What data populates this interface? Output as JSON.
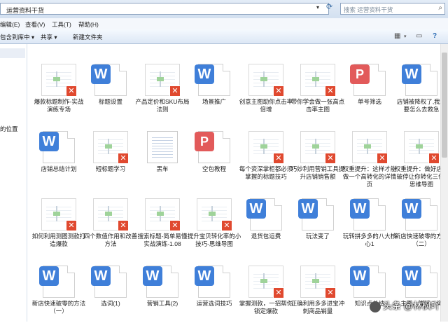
{
  "address": {
    "path": "运营资料干货",
    "search_placeholder": "搜索 运营资料干货"
  },
  "menu": [
    "编辑(E)",
    "查看(V)",
    "工具(T)",
    "帮助(H)"
  ],
  "toolbar": {
    "include": "包含到库中 ▾",
    "share": "共享 ▾",
    "new_folder": "新建文件夹"
  },
  "nav": {
    "location": "的位置"
  },
  "files": [
    {
      "name": "爆款标题制作-实战演练专场",
      "type": "ppt"
    },
    {
      "name": "标题设置",
      "type": "w"
    },
    {
      "name": "产品定价和SKU布局法则",
      "type": "ppt"
    },
    {
      "name": "场景推广",
      "type": "w"
    },
    {
      "name": "创意主图助你点击率倍增",
      "type": "ppt"
    },
    {
      "name": "带你学会做一张高点击率主图",
      "type": "ppt"
    },
    {
      "name": "单号筛选",
      "type": "p"
    },
    {
      "name": "店铺被降权了,我们要怎么去救急",
      "type": "w"
    },
    {
      "name": "店铺总结计划",
      "type": "w"
    },
    {
      "name": "短标题学习",
      "type": "ppt"
    },
    {
      "name": "黑车",
      "type": "txt"
    },
    {
      "name": "空包教程",
      "type": "p"
    },
    {
      "name": "每个资深掌柜都必须掌握的标题技巧",
      "type": "ppt"
    },
    {
      "name": "巧妙利用营销工具提升店铺销售额",
      "type": "ppt"
    },
    {
      "name": "权重提升：这样才能做一个高转化的详情页",
      "type": "ppt"
    },
    {
      "name": "权重提升：做好店铺破停让你转化三倍-思维导图",
      "type": "ppt"
    },
    {
      "name": "如何利用测图测款打造爆款",
      "type": "ppt"
    },
    {
      "name": "四个数值作用和改善方法",
      "type": "ppt"
    },
    {
      "name": "搜索标题-简单易懂实战演练-1.08",
      "type": "ppt"
    },
    {
      "name": "提升宝贝转化率的小技巧-思维导图",
      "type": "ppt"
    },
    {
      "name": "退货包运费",
      "type": "w"
    },
    {
      "name": "玩法变了",
      "type": "w"
    },
    {
      "name": "玩转拼多多的八大核心1",
      "type": "w"
    },
    {
      "name": "新店快速破零的方法（二）",
      "type": "w"
    },
    {
      "name": "新店快速破零的方法（一）",
      "type": "w"
    },
    {
      "name": "选词(1)",
      "type": "w"
    },
    {
      "name": "营销工具(2)",
      "type": "w"
    },
    {
      "name": "运营选词技巧",
      "type": "w"
    },
    {
      "name": "掌握测款，一招帮你锁定爆款",
      "type": "ppt"
    },
    {
      "name": "正确利用多多进宝冲刺商品销量",
      "type": "ppt"
    },
    {
      "name": "知识点总结",
      "type": "w"
    },
    {
      "name": "主图、描述、详",
      "type": "w"
    }
  ],
  "watermark": "头条 @林枫吖"
}
